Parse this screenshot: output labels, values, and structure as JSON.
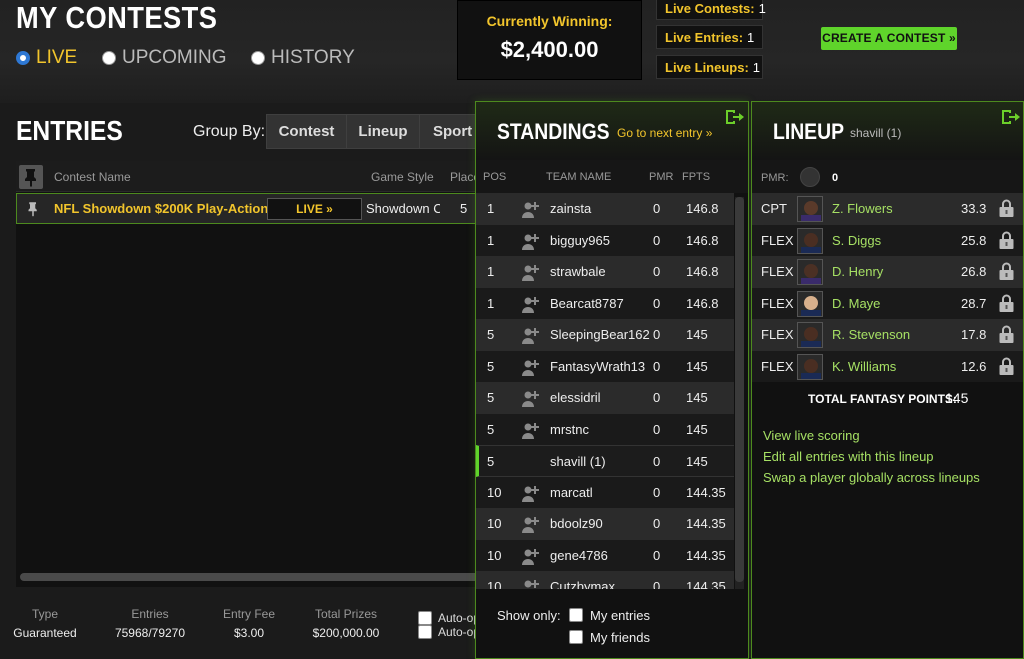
{
  "header": {
    "title": "MY CONTESTS",
    "tabs": [
      {
        "label": "LIVE",
        "selected": true
      },
      {
        "label": "UPCOMING",
        "selected": false
      },
      {
        "label": "HISTORY",
        "selected": false
      }
    ],
    "winning_label": "Currently Winning:",
    "winning_value": "$2,400.00",
    "live_contests_label": "Live Contests:",
    "live_contests_value": "1",
    "live_entries_label": "Live Entries:",
    "live_entries_value": "1",
    "live_lineups_label": "Live Lineups:",
    "live_lineups_value": "1",
    "create_button": "CREATE A CONTEST »"
  },
  "entries": {
    "title": "ENTRIES",
    "group_by_label": "Group By:",
    "group_by_buttons": [
      "Contest",
      "Lineup",
      "Sport"
    ],
    "columns": {
      "name": "Contest Name",
      "style": "Game Style",
      "place": "Place"
    },
    "row": {
      "name": "NFL Showdown $200K Play-Action",
      "status": "LIVE »",
      "style": "Showdown Captain Mode",
      "place": "5"
    }
  },
  "footer": {
    "type_label": "Type",
    "type_value": "Guaranteed",
    "entries_label": "Entries",
    "entries_value": "75968/79270",
    "fee_label": "Entry Fee",
    "fee_value": "$3.00",
    "prizes_label": "Total Prizes",
    "prizes_value": "$200,000.00",
    "auto_label_1": "Auto-op",
    "auto_label_2": "Auto-op"
  },
  "standings": {
    "title": "STANDINGS",
    "next_link": "Go to next entry »",
    "columns": {
      "pos": "POS",
      "team": "TEAM NAME",
      "pmr": "PMR",
      "fpts": "FPTS"
    },
    "rows": [
      {
        "pos": "1",
        "team": "zainsta",
        "pmr": "0",
        "fpts": "146.8"
      },
      {
        "pos": "1",
        "team": "bigguy965",
        "pmr": "0",
        "fpts": "146.8"
      },
      {
        "pos": "1",
        "team": "strawbale",
        "pmr": "0",
        "fpts": "146.8"
      },
      {
        "pos": "1",
        "team": "Bearcat8787",
        "pmr": "0",
        "fpts": "146.8"
      },
      {
        "pos": "5",
        "team": "SleepingBear162",
        "pmr": "0",
        "fpts": "145"
      },
      {
        "pos": "5",
        "team": "FantasyWrath13",
        "pmr": "0",
        "fpts": "145"
      },
      {
        "pos": "5",
        "team": "elessidril",
        "pmr": "0",
        "fpts": "145"
      },
      {
        "pos": "5",
        "team": "mrstnc",
        "pmr": "0",
        "fpts": "145"
      },
      {
        "pos": "5",
        "team": "shavill (1)",
        "pmr": "0",
        "fpts": "145",
        "me": true
      },
      {
        "pos": "10",
        "team": "marcatl",
        "pmr": "0",
        "fpts": "144.35"
      },
      {
        "pos": "10",
        "team": "bdoolz90",
        "pmr": "0",
        "fpts": "144.35"
      },
      {
        "pos": "10",
        "team": "gene4786",
        "pmr": "0",
        "fpts": "144.35"
      },
      {
        "pos": "10",
        "team": "Cutzbymax",
        "pmr": "0",
        "fpts": "144.35"
      }
    ],
    "show_only_label": "Show only:",
    "my_entries": "My entries",
    "my_friends": "My friends"
  },
  "lineup": {
    "title": "LINEUP",
    "user": "shavill (1)",
    "pmr_label": "PMR:",
    "pmr_value": "0",
    "players": [
      {
        "pos": "CPT",
        "name": "Z. Flowers",
        "pts": "33.3",
        "skin": "#5a3a2a",
        "jersey": "#3a2b6b"
      },
      {
        "pos": "FLEX",
        "name": "S. Diggs",
        "pts": "25.8",
        "skin": "#4a2e22",
        "jersey": "#1a2a55"
      },
      {
        "pos": "FLEX",
        "name": "D. Henry",
        "pts": "26.8",
        "skin": "#4b3024",
        "jersey": "#3a2b6b"
      },
      {
        "pos": "FLEX",
        "name": "D. Maye",
        "pts": "28.7",
        "skin": "#d8b08c",
        "jersey": "#1a2a55"
      },
      {
        "pos": "FLEX",
        "name": "R. Stevenson",
        "pts": "17.8",
        "skin": "#4a2e22",
        "jersey": "#1a2a55"
      },
      {
        "pos": "FLEX",
        "name": "K. Williams",
        "pts": "12.6",
        "skin": "#4a2e22",
        "jersey": "#1a2a55"
      }
    ],
    "total_label": "TOTAL FANTASY POINTS:",
    "total_value": "145",
    "links": [
      "View live scoring",
      "Edit all entries with this lineup",
      "Swap a player globally across lineups"
    ]
  },
  "colors": {
    "accent_yellow": "#f2c52c",
    "accent_green": "#5fd42b",
    "link_green": "#a6e064"
  }
}
